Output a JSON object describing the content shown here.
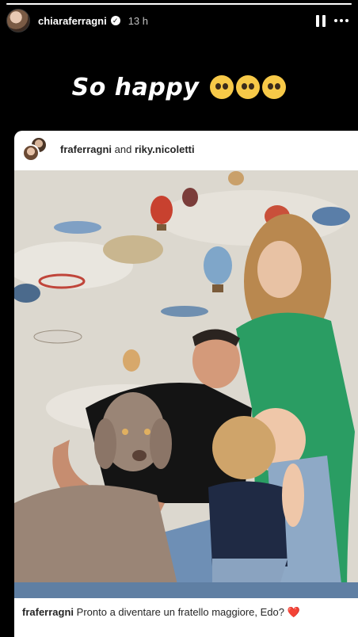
{
  "story": {
    "progress": 1.0
  },
  "header": {
    "username": "chiaraferragni",
    "time": "13 h",
    "pause_icon": "pause-icon",
    "more_icon": "more-icon"
  },
  "caption": {
    "text": "So happy",
    "emoji_count": 3,
    "emoji_name": "pleading-face-emoji"
  },
  "post": {
    "author1": "fraferragni",
    "and": "and",
    "author2": "riky.nicoletti",
    "caption_author": "fraferragni",
    "caption_text": "Pronto a diventare un fratello maggiore, Edo?",
    "caption_emoji": "❤️"
  },
  "colors": {
    "background": "#000000",
    "card": "#ffffff",
    "sweater": "#2a9d63",
    "heart": "#e0245e"
  }
}
